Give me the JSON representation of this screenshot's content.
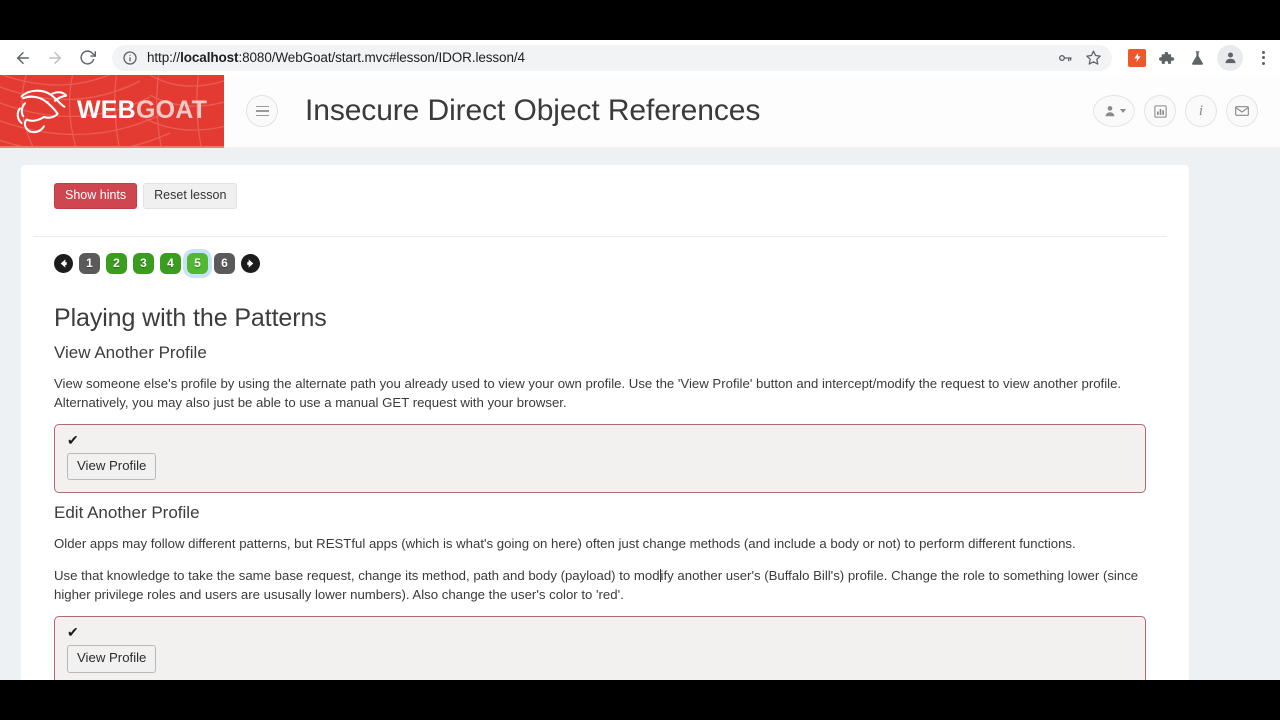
{
  "browser": {
    "back_icon": "back-arrow-icon",
    "forward_icon": "forward-arrow-icon",
    "reload_icon": "reload-icon",
    "url_prefix": "http://",
    "url_host": "localhost",
    "url_rest": ":8080/WebGoat/start.mvc#lesson/IDOR.lesson/4",
    "url_full": "http://localhost:8080/WebGoat/start.mvc#lesson/IDOR.lesson/4",
    "info_icon": "site-info-icon",
    "key_icon": "password-key-icon",
    "star_icon": "bookmark-star-icon",
    "extension_bolt_icon": "lightning-extension-icon",
    "puzzle_icon": "extensions-puzzle-icon",
    "flask_icon": "flask-extension-icon",
    "profile_icon": "profile-avatar-icon",
    "menu_icon": "three-dot-menu-icon"
  },
  "app": {
    "logo_web": "WEB",
    "logo_goat": "GOAT",
    "menu_icon": "hamburger-menu-icon",
    "lesson_title": "Insecure Direct Object References",
    "header_icons": [
      {
        "name": "user-menu-icon",
        "glyph": "♟"
      },
      {
        "name": "scoreboard-chart-icon",
        "glyph": "█"
      },
      {
        "name": "about-info-icon",
        "glyph": "i"
      },
      {
        "name": "contact-mail-icon",
        "glyph": "✉"
      }
    ]
  },
  "lesson": {
    "show_hints_label": "Show hints",
    "reset_lesson_label": "Reset lesson",
    "pager": {
      "prev_icon": "pager-prev-arrow-icon",
      "next_icon": "pager-next-arrow-icon",
      "pages": [
        {
          "label": "1",
          "state": "gray"
        },
        {
          "label": "2",
          "state": "green"
        },
        {
          "label": "3",
          "state": "green"
        },
        {
          "label": "4",
          "state": "green"
        },
        {
          "label": "5",
          "state": "current"
        },
        {
          "label": "6",
          "state": "gray"
        }
      ]
    },
    "heading": "Playing with the Patterns",
    "section1": {
      "subheading": "View Another Profile",
      "paragraph": "View someone else's profile by using the alternate path you already used to view your own profile. Use the 'View Profile' button and intercept/modify the request to view another profile. Alternatively, you may also just be able to use a manual GET request with your browser.",
      "check_mark": "✔",
      "button_label": "View Profile"
    },
    "section2": {
      "subheading": "Edit Another Profile",
      "paragraph1": "Older apps may follow different patterns, but RESTful apps (which is what's going on here) often just change methods (and include a body or not) to perform different functions.",
      "paragraph2_part1": "Use that knowledge to take the same base request, change its method, path and body (payload) to mod",
      "paragraph2_part2": "ify another user's (Buffalo Bill's) profile. Change the role to something lower (since higher privilege roles and users are ususally lower numbers). Also change the user's color to 'red'.",
      "check_mark": "✔",
      "button_label": "View Profile"
    }
  },
  "colors": {
    "brand_red": "#e33b32",
    "hint_button": "#cf4550",
    "page_green": "#3b9d20",
    "page_current_green": "#52b832",
    "attack_box_border": "#b06a72",
    "app_background": "#eef1f4"
  }
}
